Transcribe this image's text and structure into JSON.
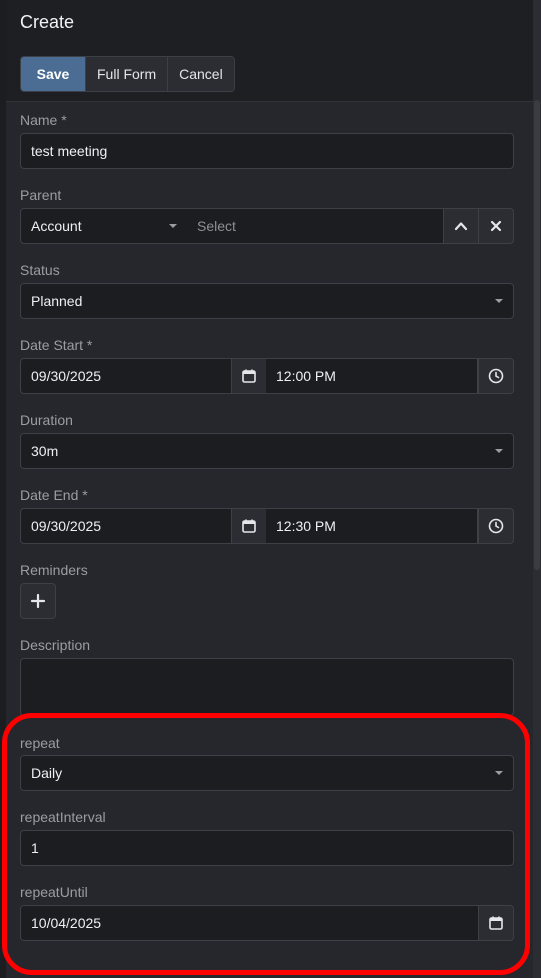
{
  "dialog": {
    "title": "Create"
  },
  "toolbar": {
    "save_label": "Save",
    "full_form_label": "Full Form",
    "cancel_label": "Cancel"
  },
  "fields": {
    "name": {
      "label": "Name *",
      "value": "test meeting"
    },
    "parent": {
      "label": "Parent",
      "type_value": "Account",
      "select_placeholder": "Select"
    },
    "status": {
      "label": "Status",
      "value": "Planned"
    },
    "date_start": {
      "label": "Date Start *",
      "date": "09/30/2025",
      "time": "12:00 PM"
    },
    "duration": {
      "label": "Duration",
      "value": "30m"
    },
    "date_end": {
      "label": "Date End *",
      "date": "09/30/2025",
      "time": "12:30 PM"
    },
    "reminders": {
      "label": "Reminders"
    },
    "description": {
      "label": "Description",
      "value": ""
    },
    "repeat": {
      "label": "repeat",
      "value": "Daily"
    },
    "repeat_interval": {
      "label": "repeatInterval",
      "value": "1"
    },
    "repeat_until": {
      "label": "repeatUntil",
      "value": "10/04/2025"
    }
  },
  "icons": {
    "calendar": "calendar-icon",
    "clock": "clock-icon",
    "plus": "plus-icon",
    "close": "close-icon",
    "chevron_up": "chevron-up-icon",
    "caret_down": "caret-down-icon"
  },
  "colors": {
    "primary": "#4c6d93",
    "highlight": "#ff0000",
    "background": "#25272c"
  }
}
